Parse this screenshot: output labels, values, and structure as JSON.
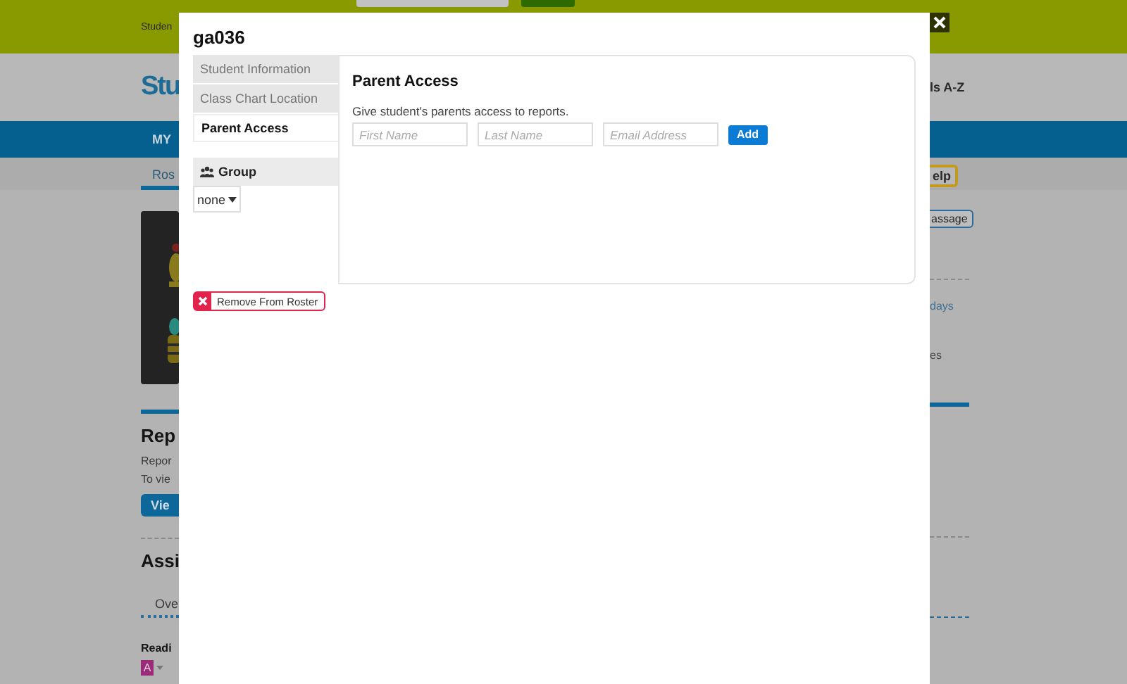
{
  "background": {
    "banner_text": "Studen",
    "logo": "Stu",
    "nav_label": "MY",
    "tab": "Ros",
    "section_heading": "Rep",
    "report_text": "Repor",
    "view_text": "To vie",
    "view_button": "Vie",
    "assign_heading": "Assi",
    "overview_tab": "Ove",
    "reading_label": "Readi",
    "badge": "A",
    "right_nav_link": "ls A-Z",
    "help_button": "elp",
    "message_button": "assage",
    "days_link": "days",
    "right_text": "es"
  },
  "modal": {
    "title": "ga036",
    "nav": [
      {
        "label": "Student Information",
        "selected": false
      },
      {
        "label": "Class Chart Location",
        "selected": false
      },
      {
        "label": "Parent Access",
        "selected": true
      }
    ],
    "group": {
      "label": "Group",
      "value": "none"
    },
    "panel": {
      "heading": "Parent Access",
      "description": "Give student's parents access to reports.",
      "fields": [
        {
          "placeholder": "First Name"
        },
        {
          "placeholder": "Last Name"
        },
        {
          "placeholder": "Email Address"
        }
      ],
      "add_button": "Add"
    },
    "remove_button": "Remove From Roster"
  }
}
